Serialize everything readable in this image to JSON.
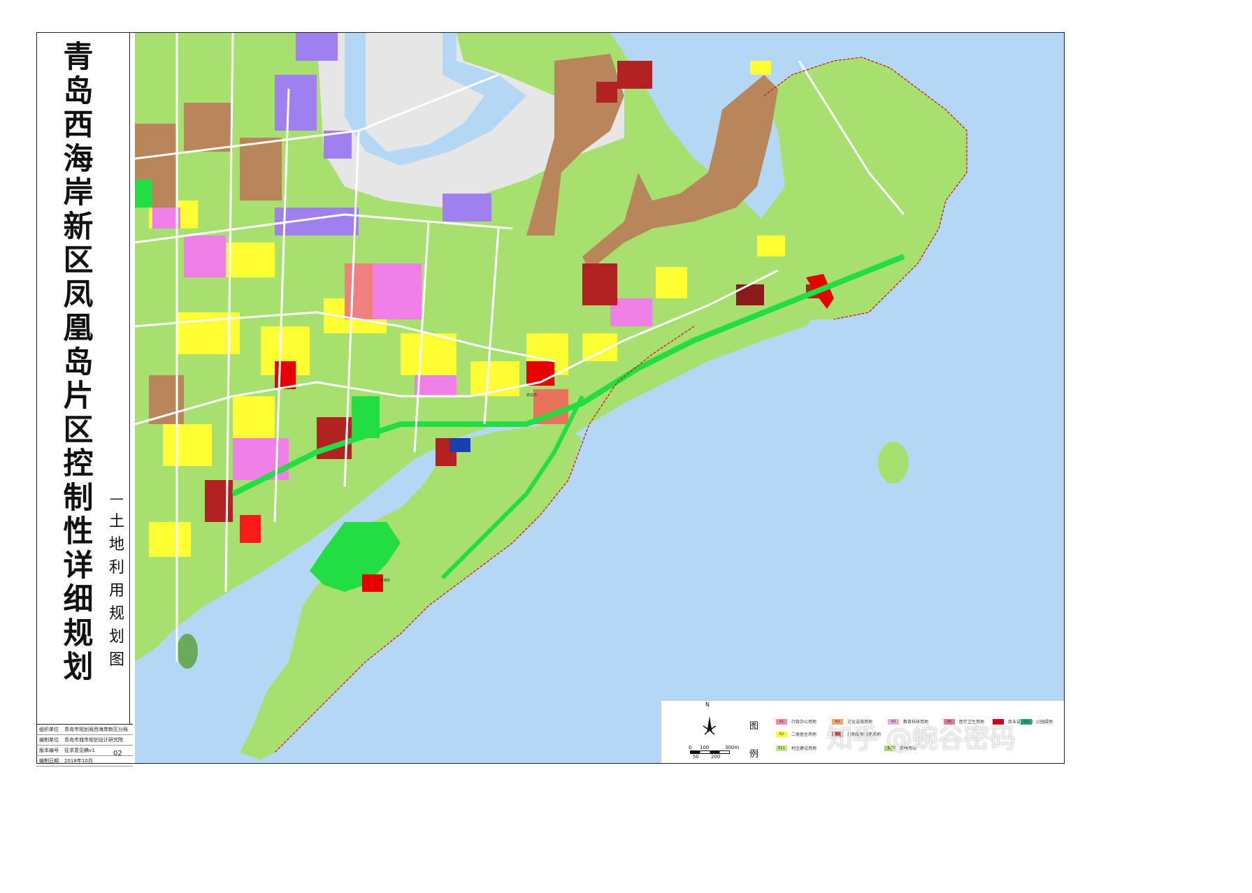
{
  "title": {
    "main": "青岛西海岸新区凤凰岛片区控制性详细规划",
    "dash": "—",
    "subtitle": "土地利用规划图"
  },
  "info": [
    {
      "label": "组织单位",
      "value": "青岛市规划局西海岸新区分局"
    },
    {
      "label": "编制单位",
      "value": "青岛市城市规划设计研究院"
    },
    {
      "label": "版本编号",
      "value": "征求意见稿v1"
    },
    {
      "label": "编制日期",
      "value": "2018年10月"
    }
  ],
  "sheet_number": "02",
  "north": {
    "label": "N"
  },
  "scale": {
    "ticks": [
      "0",
      "100",
      "300m"
    ],
    "ticks_lower": [
      "50",
      "200"
    ]
  },
  "legend": {
    "title": "图例",
    "items": [
      {
        "code": "A1",
        "label": "行政办公用地",
        "color": "#f28cb0"
      },
      {
        "code": "A2",
        "label": "文化设施用地",
        "color": "#f5a46e"
      },
      {
        "code": "A3",
        "label": "教育科研用地",
        "color": "#e8b0d8"
      },
      {
        "code": "A5",
        "label": "医疗卫生用地",
        "color": "#e07aa0"
      },
      {
        "code": "B1",
        "label": "商业设施用地",
        "color": "#d40020"
      },
      {
        "code": "G1",
        "label": "公园绿地",
        "color": "#1fa66b"
      },
      {
        "code": "R2",
        "label": "二类居住用地",
        "color": "#ffff33"
      },
      {
        "code": "B9",
        "label": "其他服务设施用地",
        "color": "#e8735a"
      },
      {
        "code": "E11",
        "label": "村庄建设用地",
        "color": "#c9e28a"
      },
      {
        "code": "E2",
        "label": "农林用地",
        "color": "#a8d96c"
      }
    ]
  },
  "map_labels": [
    {
      "text": "西海岸",
      "color": "#333333"
    },
    {
      "text": "唐岛湾",
      "color": "#333333"
    }
  ],
  "watermark": "知乎 @蜿谷密码",
  "colors": {
    "water": "#b3d7f5",
    "agri": "#a8e070",
    "residential": "#ffff33",
    "commercial": "#cc1f1f",
    "industrial": "#b8865a",
    "education": "#f080e8",
    "logistics": "#a080f0",
    "green": "#22dd44",
    "port": "#e6e6e6",
    "road": "#ffffff"
  }
}
